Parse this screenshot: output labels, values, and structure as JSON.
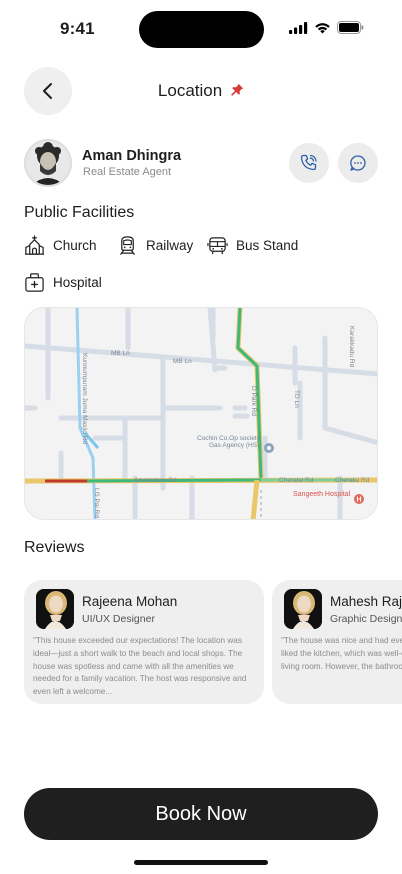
{
  "status": {
    "time": "9:41"
  },
  "header": {
    "back_icon": "chevron-left-icon",
    "title": "Location",
    "title_icon": "pushpin-icon"
  },
  "agent": {
    "name": "Aman Dhingra",
    "role": "Real Estate Agent",
    "call_icon": "phone-icon",
    "chat_icon": "chat-bubble-icon"
  },
  "facilities": {
    "title": "Public Facilities",
    "items": [
      {
        "label": "Church",
        "icon": "church-icon"
      },
      {
        "label": "Railway",
        "icon": "train-icon"
      },
      {
        "label": "Bus Stand",
        "icon": "bus-icon"
      },
      {
        "label": "Hospital",
        "icon": "hospital-icon"
      }
    ]
  },
  "map": {
    "labels": {
      "mb_ln_1": "MB Ln",
      "mb_ln_2": "MB Ln",
      "kunnumpuram": "Kunnumpuram Juma Masjid Rd",
      "ammankov": "Ammankov Rd",
      "lg_pai": "LG Pai Rd",
      "d_park": "D Park Rd",
      "td_ln": "TD Ln",
      "karaka": "Karakkadu Rd",
      "cheralai_1": "Cheralai Rd",
      "cheralai_2": "Cheralai Rd",
      "cochin": "Cochin Co.Op society",
      "gas": "Gas Agency (HS)",
      "sangeeth": "Sangeeth Hospital"
    }
  },
  "reviews": {
    "title": "Reviews",
    "items": [
      {
        "name": "Rajeena Mohan",
        "role": "UI/UX Designer",
        "text": "\"This house exceeded our expectations! The location was ideal—just a short walk to the beach and local shops. The house was spotless and came with all the amenities we needed for a family vacation. The host was responsive and even left a welcome..."
      },
      {
        "name": "Mahesh Raj",
        "role": "Graphic Designer",
        "text": "\"The house was nice and had everything we needed. We liked the kitchen, which was well-equipped, and the spacious living room. However, the bathroom could use an update..."
      }
    ]
  },
  "book_button": {
    "label": "Book Now"
  },
  "colors": {
    "primary": "#1f1f1f",
    "card_bg": "#efefef",
    "route_green": "#3fb87e",
    "route_red": "#c0392b",
    "road_yellow": "#e8c86a"
  }
}
